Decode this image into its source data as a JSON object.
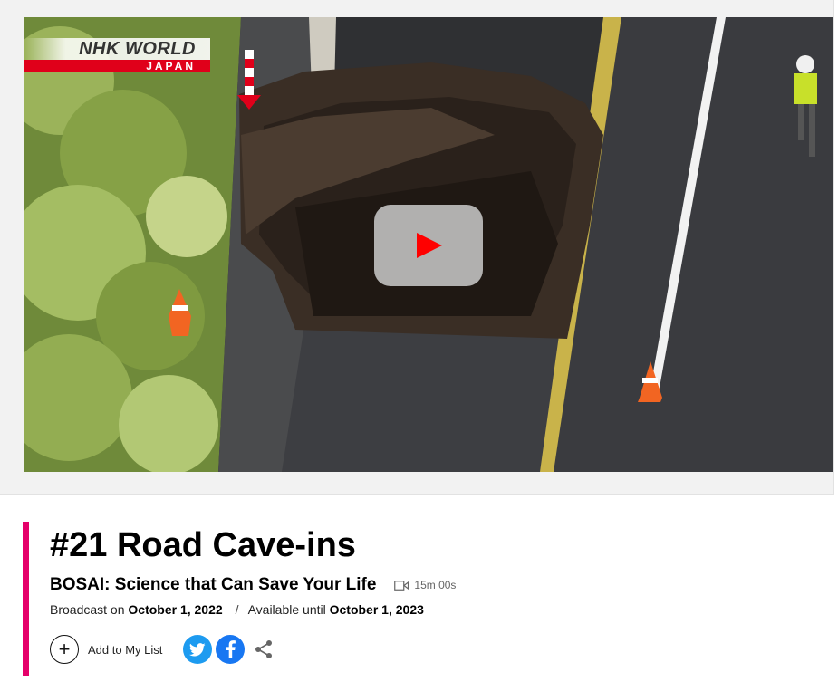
{
  "video": {
    "channel_logo_top": "NHK WORLD",
    "channel_logo_bottom": "JAPAN",
    "thumbnail_subject": "aerial view of road cave-in sinkhole",
    "play_icon": "play-icon"
  },
  "episode": {
    "title": "#21 Road Cave-ins",
    "program": "BOSAI: Science that Can Save Your Life",
    "duration_icon": "video-camera-icon",
    "duration": "15m 00s",
    "broadcast_label": "Broadcast on",
    "broadcast_date": "October 1, 2022",
    "separator": "/",
    "available_label": "Available until",
    "available_date": "October 1, 2023"
  },
  "actions": {
    "add_icon": "plus-icon",
    "add_label": "Add to My List",
    "share": [
      {
        "name": "twitter-icon",
        "color": "#1d9bf0"
      },
      {
        "name": "facebook-icon",
        "color": "#1877f2"
      },
      {
        "name": "share-icon",
        "color": "#666666"
      }
    ]
  },
  "colors": {
    "accent": "#e5006a",
    "play": "#ff0000",
    "logo_red": "#e0001a"
  }
}
